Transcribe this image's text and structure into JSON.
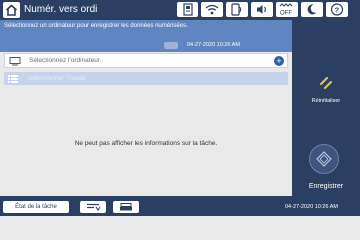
{
  "topbar": {
    "title": "Numér. vers ordi"
  },
  "status_icons": [
    {
      "icon": "device-status-icon"
    },
    {
      "icon": "wifi-icon"
    },
    {
      "icon": "wifi-direct-icon"
    },
    {
      "icon": "volume-icon"
    },
    {
      "icon": "quiet-mode-off-icon",
      "text": "OFF"
    },
    {
      "icon": "sleep-moon-icon"
    },
    {
      "icon": "help-icon"
    }
  ],
  "main": {
    "message": "Sélectionnez un ordinateur pour enregistrer les données numérisées.",
    "datetime": "04-27-2020 10:26 AM",
    "destination_placeholder": "Sélectionnez l'ordinateur.",
    "folder_placeholder": "Sélectionner Travail",
    "info_text": "Ne peut pas afficher les informations sur la tâche."
  },
  "right_panel": {
    "reset_label": "Réinitialiser",
    "start_label": "Enregistrer"
  },
  "bottombar": {
    "job_status_label": "État de la tâche",
    "datetime": "04-27-2020 10:26 AM"
  },
  "colors": {
    "bar": "#2b3f63",
    "header_blue": "#5f86c0",
    "accent_yellow": "#e2c23a",
    "add_button": "#2f5fa8"
  }
}
